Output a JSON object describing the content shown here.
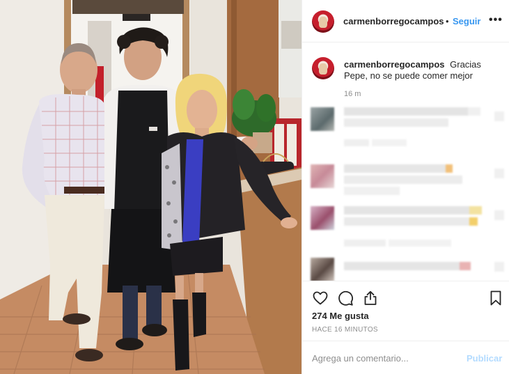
{
  "post": {
    "username": "carmenborregocampos",
    "follow_label": "Seguir",
    "separator": "•",
    "more_label": "•••",
    "caption": {
      "username": "carmenborregocampos",
      "text": "Gracias Pepe, no se puede comer mejor",
      "time": "16 m"
    },
    "likes": "274 Me gusta",
    "timestamp": "HACE 16 MINUTOS",
    "comment_placeholder": "Agrega un comentario...",
    "publish_label": "Publicar"
  },
  "icons": {
    "like": "heart-icon",
    "comment": "speech-bubble-icon",
    "share": "share-icon",
    "save": "bookmark-icon",
    "more": "ellipsis-icon"
  },
  "colors": {
    "accent": "#3897f0",
    "publish_disabled": "#b3dbff",
    "text": "#262626",
    "muted": "#8e8e8e",
    "border": "#efefef"
  }
}
